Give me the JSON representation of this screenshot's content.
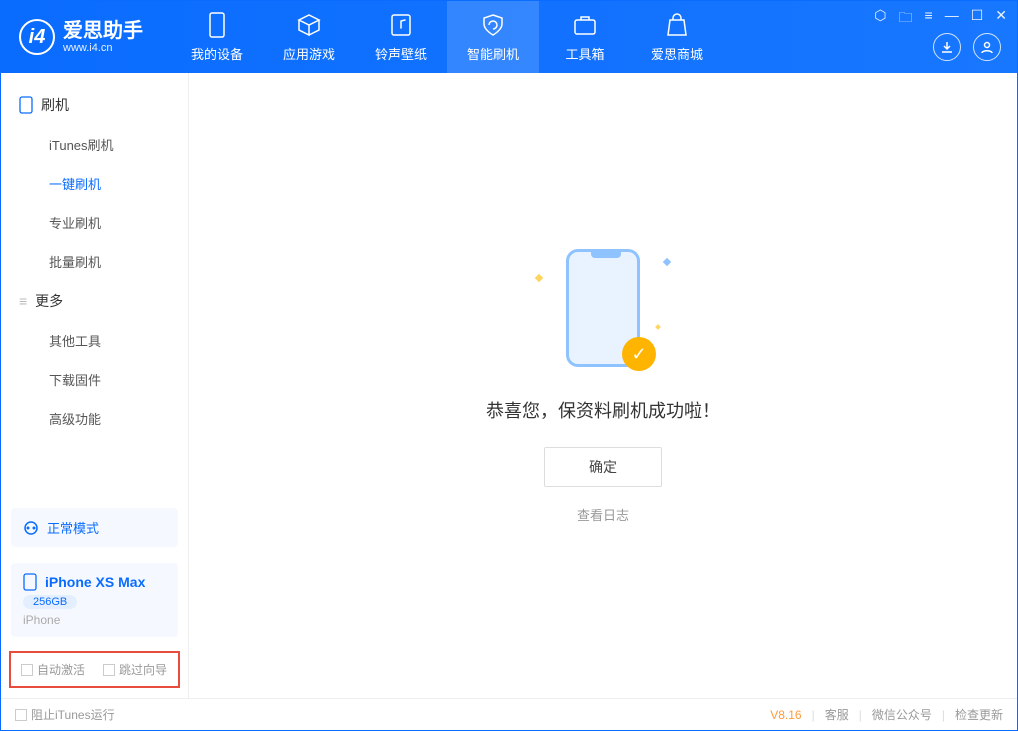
{
  "app": {
    "name": "爱思助手",
    "url": "www.i4.cn"
  },
  "nav": {
    "items": [
      {
        "label": "我的设备"
      },
      {
        "label": "应用游戏"
      },
      {
        "label": "铃声壁纸"
      },
      {
        "label": "智能刷机"
      },
      {
        "label": "工具箱"
      },
      {
        "label": "爱思商城"
      }
    ]
  },
  "sidebar": {
    "group1": "刷机",
    "items1": [
      {
        "label": "iTunes刷机"
      },
      {
        "label": "一键刷机"
      },
      {
        "label": "专业刷机"
      },
      {
        "label": "批量刷机"
      }
    ],
    "group2": "更多",
    "items2": [
      {
        "label": "其他工具"
      },
      {
        "label": "下载固件"
      },
      {
        "label": "高级功能"
      }
    ],
    "mode": "正常模式",
    "device": {
      "name": "iPhone XS Max",
      "capacity": "256GB",
      "type": "iPhone"
    },
    "options": {
      "auto_activate": "自动激活",
      "skip_guide": "跳过向导"
    }
  },
  "main": {
    "message": "恭喜您，保资料刷机成功啦！",
    "ok": "确定",
    "view_log": "查看日志"
  },
  "footer": {
    "block_itunes": "阻止iTunes运行",
    "version": "V8.16",
    "links": [
      "客服",
      "微信公众号",
      "检查更新"
    ]
  }
}
